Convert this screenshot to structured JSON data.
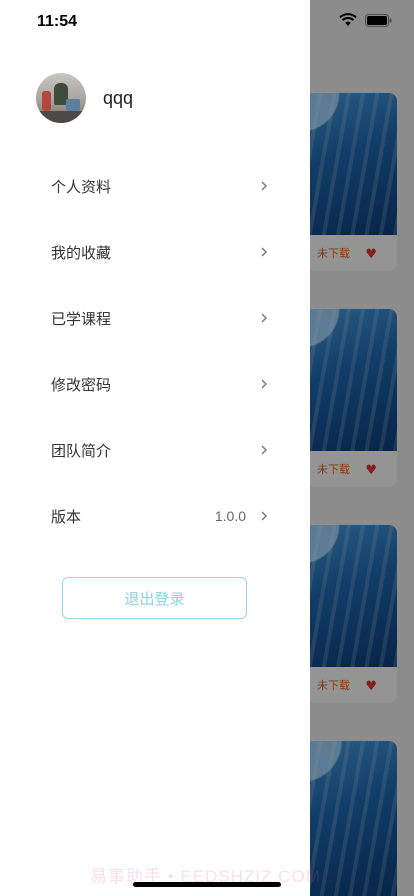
{
  "status_bar": {
    "time": "11:54",
    "icons": [
      "wifi-icon",
      "battery-icon"
    ]
  },
  "profile": {
    "username": "qqq"
  },
  "menu": [
    {
      "label": "个人资料",
      "value": ""
    },
    {
      "label": "我的收藏",
      "value": ""
    },
    {
      "label": "已学课程",
      "value": ""
    },
    {
      "label": "修改密码",
      "value": ""
    },
    {
      "label": "团队简介",
      "value": ""
    },
    {
      "label": "版本",
      "value": "1.0.0"
    }
  ],
  "logout_label": "退出登录",
  "background_cards": [
    {
      "download_label": "未下载"
    },
    {
      "download_label": "未下载"
    },
    {
      "download_label": "未下载"
    },
    {
      "download_label": ""
    }
  ],
  "watermark": "易事助手 • EEDSHZIZ.COM",
  "colors": {
    "accent": "#8fd0e0",
    "heart": "#e03c3c",
    "download": "#e0662b"
  }
}
